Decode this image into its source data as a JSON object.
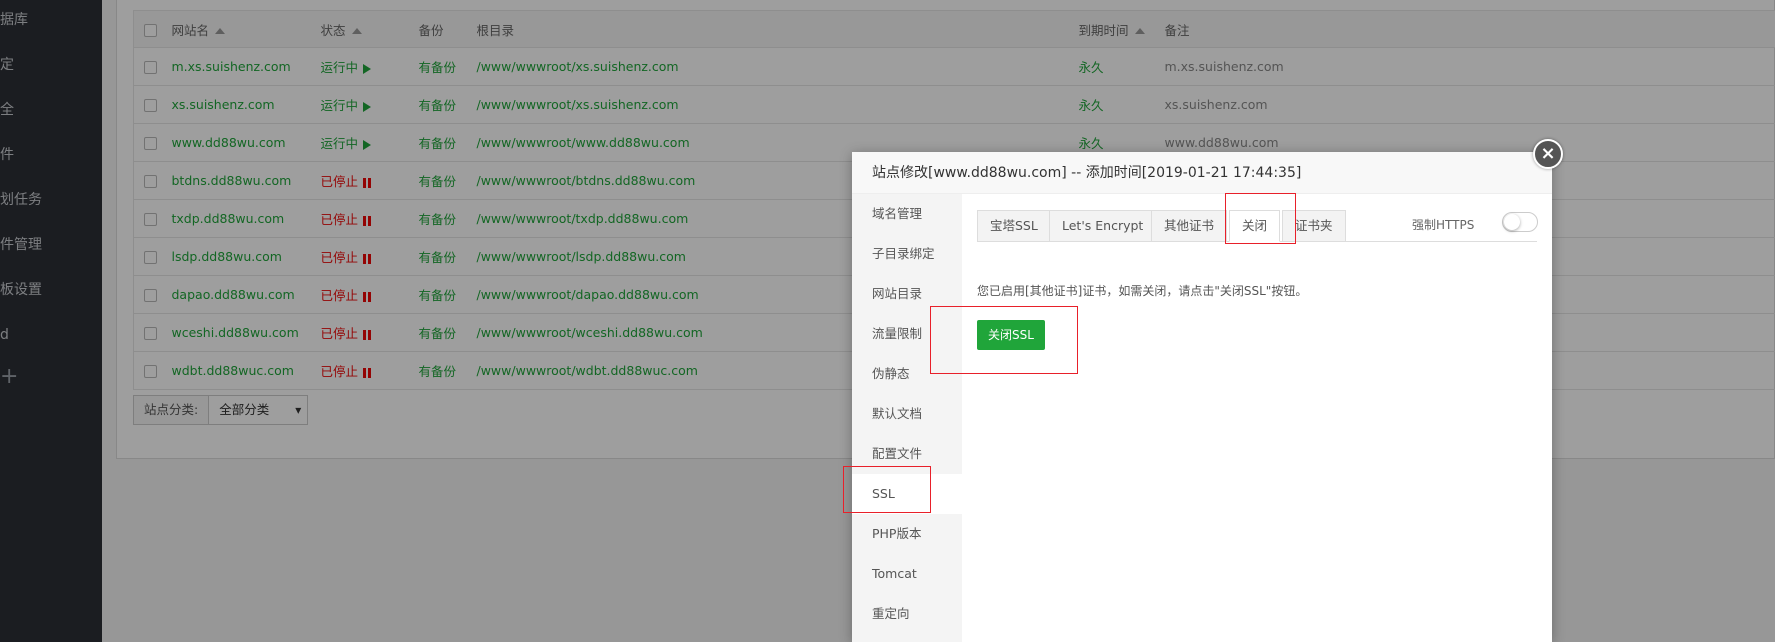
{
  "sidebar": {
    "items": [
      "据库",
      "定",
      "全",
      "件",
      "划任务",
      "件管理",
      "板设置",
      "d"
    ],
    "plus": "+"
  },
  "table": {
    "headers": {
      "name": "网站名",
      "state": "状态",
      "backup": "备份",
      "root": "根目录",
      "expire": "到期时间",
      "note": "备注"
    },
    "rows": [
      {
        "name": "m.xs.suishenz.com",
        "state": "运行中",
        "running": true,
        "backup": "有备份",
        "root": "/www/wwwroot/xs.suishenz.com",
        "expire": "永久",
        "note": "m.xs.suishenz.com"
      },
      {
        "name": "xs.suishenz.com",
        "state": "运行中",
        "running": true,
        "backup": "有备份",
        "root": "/www/wwwroot/xs.suishenz.com",
        "expire": "永久",
        "note": "xs.suishenz.com"
      },
      {
        "name": "www.dd88wu.com",
        "state": "运行中",
        "running": true,
        "backup": "有备份",
        "root": "/www/wwwroot/www.dd88wu.com",
        "expire": "永久",
        "note": "www.dd88wu.com"
      },
      {
        "name": "btdns.dd88wu.com",
        "state": "已停止",
        "running": false,
        "backup": "有备份",
        "root": "/www/wwwroot/btdns.dd88wu.com",
        "expire": "",
        "note": ""
      },
      {
        "name": "txdp.dd88wu.com",
        "state": "已停止",
        "running": false,
        "backup": "有备份",
        "root": "/www/wwwroot/txdp.dd88wu.com",
        "expire": "",
        "note": ""
      },
      {
        "name": "lsdp.dd88wu.com",
        "state": "已停止",
        "running": false,
        "backup": "有备份",
        "root": "/www/wwwroot/lsdp.dd88wu.com",
        "expire": "",
        "note": ""
      },
      {
        "name": "dapao.dd88wu.com",
        "state": "已停止",
        "running": false,
        "backup": "有备份",
        "root": "/www/wwwroot/dapao.dd88wu.com",
        "expire": "",
        "note": ""
      },
      {
        "name": "wceshi.dd88wu.com",
        "state": "已停止",
        "running": false,
        "backup": "有备份",
        "root": "/www/wwwroot/wceshi.dd88wu.com",
        "expire": "",
        "note": ""
      },
      {
        "name": "wdbt.dd88wuc.com",
        "state": "已停止",
        "running": false,
        "backup": "有备份",
        "root": "/www/wwwroot/wdbt.dd88wuc.com",
        "expire": "",
        "note": ""
      }
    ]
  },
  "category": {
    "label": "站点分类:",
    "selected": "全部分类"
  },
  "dialog": {
    "title": "站点修改[www.dd88wu.com] -- 添加时间[2019-01-21 17:44:35]",
    "close": "×",
    "nav": [
      "域名管理",
      "子目录绑定",
      "网站目录",
      "流量限制",
      "伪静态",
      "默认文档",
      "配置文件",
      "SSL",
      "PHP版本",
      "Tomcat",
      "重定向"
    ],
    "tabs": [
      "宝塔SSL",
      "Let's Encrypt",
      "其他证书",
      "关闭",
      "证书夹"
    ],
    "force_https": "强制HTTPS",
    "message": "您已启用[其他证书]证书，如需关闭，请点击\"关闭SSL\"按钮。",
    "close_ssl_button": "关闭SSL"
  },
  "colors": {
    "accent_green": "#20a53a",
    "stopped_red": "#ef0808",
    "highlight": "#e8202a"
  }
}
